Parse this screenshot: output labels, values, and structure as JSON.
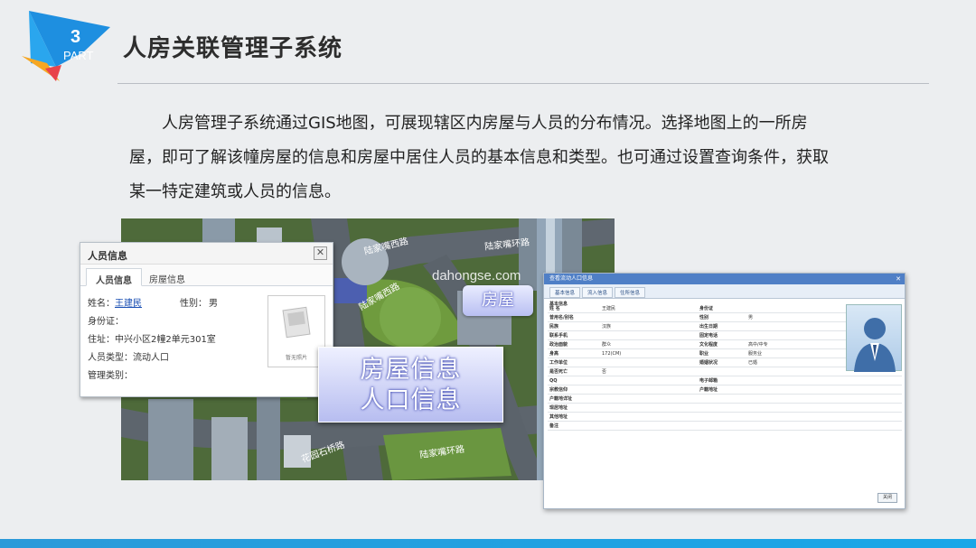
{
  "header": {
    "section_number": "3",
    "section_word": "PART",
    "title": "人房关联管理子系统"
  },
  "intro_text": "人房管理子系统通过GIS地图，可展现辖区内房屋与人员的分布情况。选择地图上的一所房屋，即可了解该幢房屋的信息和房屋中居住人员的基本信息和类型。也可通过设置查询条件，获取某一特定建筑或人员的信息。",
  "map": {
    "street_labels": [
      "陆家嘴西路",
      "陆家嘴环路",
      "陆家嘴西路",
      "花园石桥路",
      "陆家嘴环路"
    ],
    "watermark": "dahongse.com",
    "house_bubble": "房屋",
    "big_label_line1": "房屋信息",
    "big_label_line2": "人口信息"
  },
  "person_popup": {
    "title": "人员信息",
    "close_glyph": "✕",
    "tabs": [
      "人员信息",
      "房屋信息"
    ],
    "name_label": "姓名：",
    "name_value": "王建民",
    "gender_label": "性别：",
    "gender_value": "男",
    "id_label": "身份证：",
    "address_label": "住址：",
    "address_value": "中兴小区2幢2单元301室",
    "type_label": "人员类型：",
    "type_value": "流动人口",
    "category_label": "管理类别：",
    "photo_caption": "暂无照片"
  },
  "population_window": {
    "title": "查看流动人口信息",
    "close_glyph": "✕",
    "tabs": [
      "基本信息",
      "流入信息",
      "住所信息"
    ],
    "section_label": "基本信息",
    "rows": [
      {
        "l1": "姓 名",
        "v1": "王建民",
        "l2": "身份证",
        "v2": ""
      },
      {
        "l1": "曾用名/别名",
        "v1": "",
        "l2": "性别",
        "v2": "男"
      },
      {
        "l1": "民族",
        "v1": "汉族",
        "l2": "出生日期",
        "v2": ""
      },
      {
        "l1": "联系手机",
        "v1": "",
        "l2": "固定电话",
        "v2": ""
      },
      {
        "l1": "政治面貌",
        "v1": "群众",
        "l2": "文化程度",
        "v2": "高中/中专"
      },
      {
        "l1": "身高",
        "v1": "172(CM)",
        "l2": "职业",
        "v2": "服务业"
      },
      {
        "l1": "工作单位",
        "v1": "",
        "l2": "婚姻状况",
        "v2": "已婚"
      },
      {
        "l1": "是否死亡",
        "v1": "否",
        "l2": "",
        "v2": ""
      },
      {
        "l1": "QQ",
        "v1": "",
        "l2": "电子邮箱",
        "v2": ""
      },
      {
        "l1": "宗教信仰",
        "v1": "",
        "l2": "户籍地址",
        "v2": ""
      },
      {
        "l1": "户籍地详址",
        "v1": "",
        "l2": "",
        "v2": ""
      },
      {
        "l1": "现居地址",
        "v1": "",
        "l2": "",
        "v2": ""
      },
      {
        "l1": "其他地址",
        "v1": "",
        "l2": "",
        "v2": ""
      },
      {
        "l1": "备注",
        "v1": "",
        "l2": "",
        "v2": ""
      }
    ],
    "close_button": "关闭"
  },
  "colors": {
    "accent": "#1aa3e6",
    "badge_blue": "#1e8fe0",
    "badge_orange": "#f5a623",
    "badge_red": "#e8434a"
  }
}
